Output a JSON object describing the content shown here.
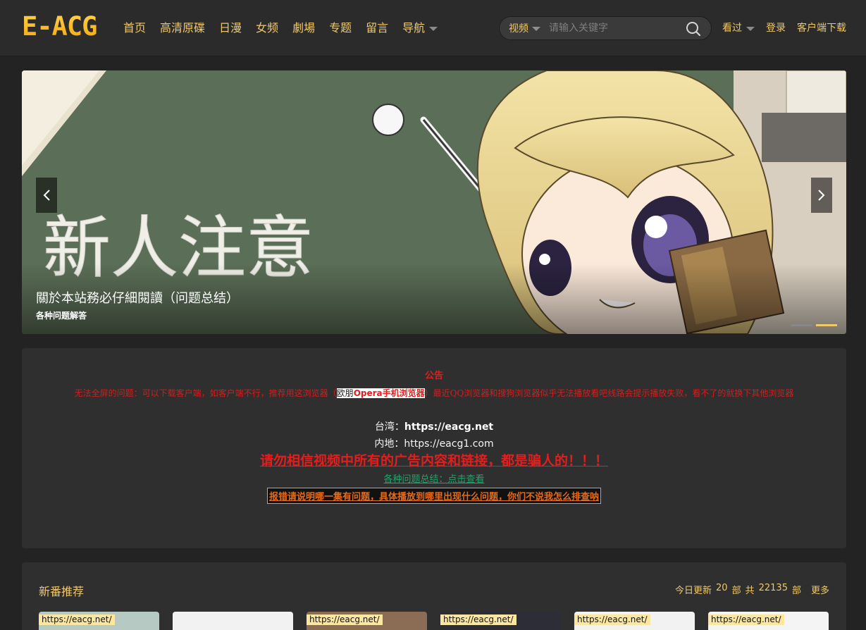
{
  "header": {
    "logo": "E-ACG",
    "nav": [
      {
        "label": "首页"
      },
      {
        "label": "高清原碟"
      },
      {
        "label": "日漫"
      },
      {
        "label": "女频"
      },
      {
        "label": "劇場"
      },
      {
        "label": "专题"
      },
      {
        "label": "留言"
      },
      {
        "label": "导航"
      }
    ],
    "search": {
      "type": "视频",
      "placeholder": "请输入关键字"
    },
    "watched": "看过",
    "login": "登录",
    "download": "客户端下载"
  },
  "banner": {
    "headline": "關於本站務必仔細閱讀（问题总结）",
    "sub": "各种问题解答",
    "art_text": "新人注意",
    "active_slide": 2,
    "slide_count": 2
  },
  "notice": {
    "title": "公告",
    "msg_before": "无法全屏的问题：可以下载客户端，如客户端不行，推荐用这浏览器（",
    "msg_hl_plain": "欧朋",
    "msg_hl_red": "Opera手机浏览器",
    "msg_after": "）最近QQ浏览器和搜狗浏览器似乎无法播放看吧线路会提示播放失败，看不了的就换下其他浏览器",
    "tw_label": "台湾：",
    "tw_url": "https://eacg.net",
    "cn_label": "内地：",
    "cn_url": "https://eacg1.com",
    "warn": "请勿相信视频中所有的广告内容和链接，都是骗人的！！！",
    "faq": "各种问题总结：点击查看",
    "report": "报错请说明哪一集有问题，具体播放到哪里出现什么问题，你们不说我怎么排查呐"
  },
  "new_anime": {
    "title": "新番推荐",
    "today_label": "今日更新",
    "today_count": "20",
    "unit1": "部",
    "total_label": "共",
    "total_count": "22135",
    "unit2": "部",
    "more": "更多",
    "thumbs": [
      {
        "caption": "https://eacg.net/",
        "color": "#b6c9c2"
      },
      {
        "caption": "",
        "color": "#f2f2f2"
      },
      {
        "caption": "https://eacg.net/",
        "color": "#8b6d55"
      },
      {
        "caption": "https://eacg.net/",
        "color": "#2d2d37"
      },
      {
        "caption": "https://eacg.net/",
        "color": "#f2f2f2"
      },
      {
        "caption": "https://eacg.net/",
        "color": "#f4f4f4"
      }
    ]
  },
  "colors": {
    "accent": "#f0c86a",
    "warn": "#e41d1d",
    "link_green": "#1fa46c"
  }
}
